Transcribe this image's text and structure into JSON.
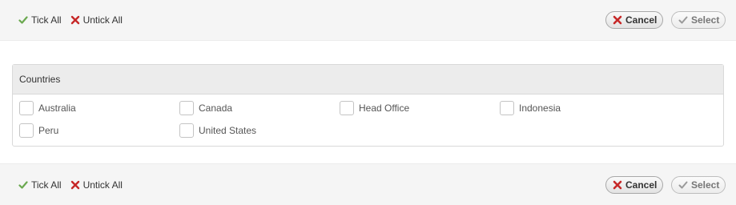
{
  "toolbar": {
    "tick_all": "Tick All",
    "untick_all": "Untick All",
    "cancel": "Cancel",
    "select": "Select"
  },
  "panel": {
    "title": "Countries",
    "options": [
      {
        "label": "Australia",
        "checked": false
      },
      {
        "label": "Canada",
        "checked": false
      },
      {
        "label": "Head Office",
        "checked": false
      },
      {
        "label": "Indonesia",
        "checked": false
      },
      {
        "label": "Peru",
        "checked": false
      },
      {
        "label": "United States",
        "checked": false
      }
    ]
  },
  "icons": {
    "tick": "check-icon",
    "untick": "cross-icon"
  },
  "colors": {
    "tick_green": "#6aa84f",
    "cross_red": "#c62828"
  }
}
